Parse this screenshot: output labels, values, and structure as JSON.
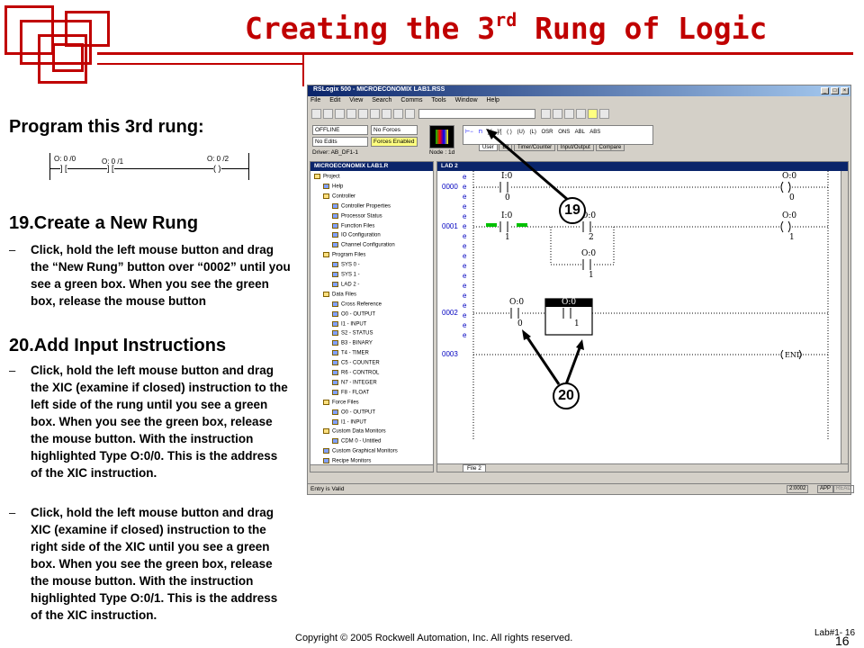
{
  "slide": {
    "title_main": "Creating the 3",
    "title_sup": "rd",
    "title_rest": " Rung of Logic",
    "intro": "Program this 3rd rung:",
    "mini_rung": {
      "a1": "O: 0 /0",
      "a2": "O: 0 /1",
      "a3": "O: 0 /2",
      "s1": "] [",
      "s2": "] [",
      "s3": "( )"
    },
    "step19_heading": "19.Create a New Rung",
    "step19_text": "Click, hold the left mouse button and drag the “New Rung” button over “0002” until you see a green box. When you see the green box, release the mouse button",
    "step20_heading": "20.Add Input Instructions",
    "step20_text1": "Click, hold the left mouse button and drag the XIC (examine if closed) instruction to the left side of the rung until you see a green box.  When you see the green box, release the mouse button. With the instruction highlighted Type O:0/0.  This is the address of the XIC instruction.",
    "step20_text2": "Click, hold the left mouse button and drag XIC (examine if closed) instruction to the right side of the XIC until you see a green box.  When you see the green box, release the mouse button. With the instruction highlighted Type O:0/1.  This is the address of the XIC instruction.",
    "bullet": "–",
    "copyright": "Copyright © 2005 Rockwell Automation, Inc. All rights reserved.",
    "lab_label": "Lab#1- 16",
    "page_number": "16",
    "callout19": "19",
    "callout20": "20"
  },
  "app": {
    "title": "RSLogix 500 - MICROECONOMIX LAB1.RSS",
    "menu": [
      "File",
      "Edit",
      "View",
      "Search",
      "Comms",
      "Tools",
      "Window",
      "Help"
    ],
    "status_fields": {
      "mode": "OFFLINE",
      "forces": "No Forces",
      "edits": "No Edits",
      "forces_enabled": "Forces Enabled",
      "driver": "Driver: AB_DF1-1",
      "node": "Node : 1d"
    },
    "instr_tabs": [
      "User",
      "Bit",
      "Timer/Counter",
      "Input/Output",
      "Compare"
    ],
    "instr_symbols": [
      "⊢−",
      "⊓",
      "] [",
      "]/[",
      "( )",
      "(U)",
      "(L)",
      "OSR",
      "ONS",
      "ABL",
      "ABS"
    ],
    "project_title": "MICROECONOMIX LAB1.R",
    "tree": [
      "Project",
      "Help",
      "Controller",
      "Controller Properties",
      "Processor Status",
      "Function Files",
      "IO Configuration",
      "Channel Configuration",
      "Program Files",
      "SYS 0 -",
      "SYS 1 -",
      "LAD 2 -",
      "Data Files",
      "Cross Reference",
      "O0 - OUTPUT",
      "I1 - INPUT",
      "S2 - STATUS",
      "B3 - BINARY",
      "T4 - TIMER",
      "C5 - COUNTER",
      "R6 - CONTROL",
      "N7 - INTEGER",
      "F8 - FLOAT",
      "Force Files",
      "O0 - OUTPUT",
      "I1 - INPUT",
      "Custom Data Monitors",
      "CDM 0 - Untitled",
      "Custom Graphical Monitors",
      "Recipe Monitors"
    ],
    "lad_title": "LAD 2",
    "rungs": [
      "0000",
      "0001",
      "0002",
      "0003"
    ],
    "lad_labels": {
      "r0_in_addr": "I:0",
      "r0_in_bit": "0",
      "r0_out_addr": "O:0",
      "r0_out_bit": "0",
      "r1_in1_addr": "I:0",
      "r1_in1_bit": "1",
      "r1_in2_addr": "O:0",
      "r1_in2_bit": "2",
      "r1_br_addr": "O:0",
      "r1_br_bit": "1",
      "r1_out_addr": "O:0",
      "r1_out_bit": "1",
      "r2_in1_addr": "O:0",
      "r2_in1_bit": "0",
      "r2_in2_addr": "O:0",
      "r2_in2_bit": "1",
      "end": "END"
    },
    "e_mark": "e",
    "tab_file": "File 2",
    "status_text": "Entry is Valid",
    "status_addr": "2:0002",
    "status_app": "APP",
    "status_read": "READ"
  }
}
